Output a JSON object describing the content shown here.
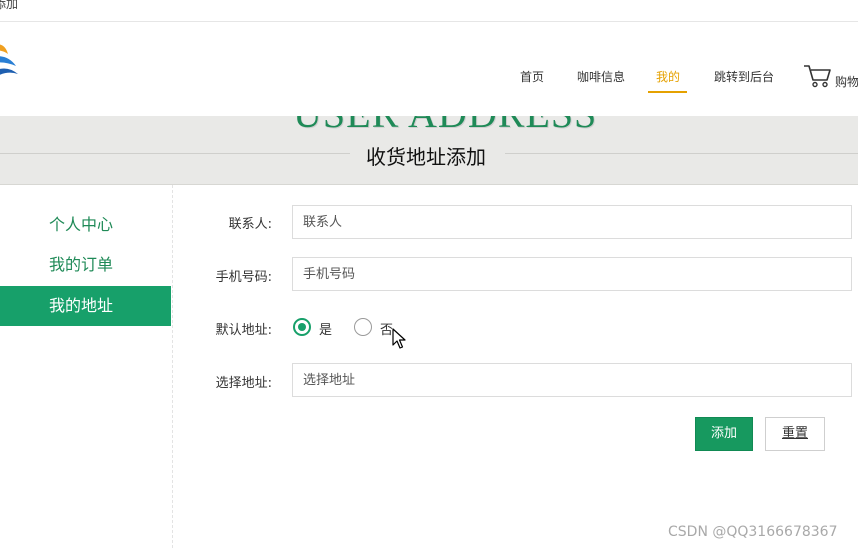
{
  "topbar": {
    "text": "添加"
  },
  "nav": {
    "items": [
      {
        "label": "首页"
      },
      {
        "label": "咖啡信息"
      },
      {
        "label": "我的"
      },
      {
        "label": "跳转到后台"
      }
    ],
    "cart_label": "购物车",
    "active_color": "#e5a100"
  },
  "banner": {
    "english": "USER ADDRESS",
    "title": "收货地址添加"
  },
  "sidebar": {
    "items": [
      {
        "label": "个人中心"
      },
      {
        "label": "我的订单"
      },
      {
        "label": "我的地址"
      }
    ],
    "active_index": 2,
    "accent_color": "#17a06a"
  },
  "form": {
    "contact": {
      "label": "联系人:",
      "placeholder": "联系人"
    },
    "phone": {
      "label": "手机号码:",
      "placeholder": "手机号码"
    },
    "default_address": {
      "label": "默认地址:",
      "options": [
        "是",
        "否"
      ],
      "selected": "是"
    },
    "address": {
      "label": "选择地址:",
      "placeholder": "选择地址"
    },
    "add_button": "添加",
    "reset_button": "重置"
  },
  "watermark": "CSDN @QQ3166678367"
}
